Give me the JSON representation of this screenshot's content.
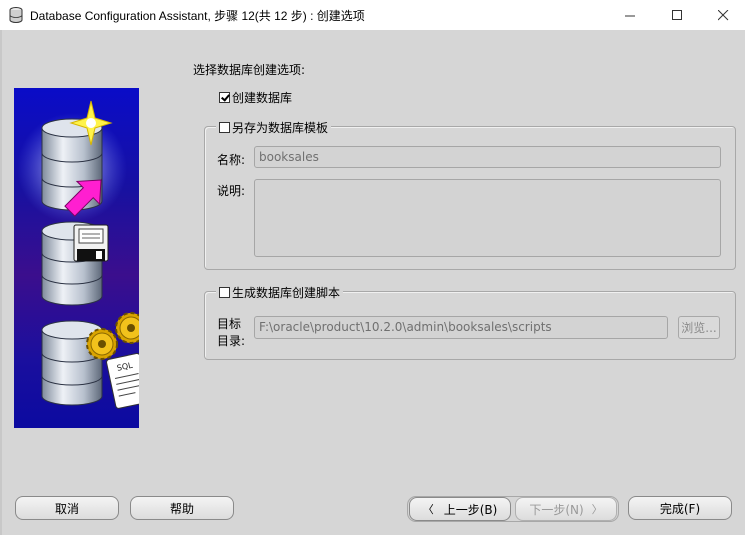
{
  "window": {
    "title": "Database Configuration Assistant, 步骤 12(共 12 步) : 创建选项",
    "minimize": "—",
    "maximize": "☐",
    "close": "✕"
  },
  "content": {
    "heading": "选择数据库创建选项:",
    "create_db": {
      "label": "创建数据库",
      "checked": true
    },
    "template_group": {
      "label": "另存为数据库模板",
      "checked": false,
      "name_label": "名称:",
      "name_value": "booksales",
      "desc_label": "说明:",
      "desc_value": ""
    },
    "script_group": {
      "label": "生成数据库创建脚本",
      "checked": false,
      "dir_label_line1": "目标",
      "dir_label_line2": "目录:",
      "dir_value": "F:\\oracle\\product\\10.2.0\\admin\\booksales\\scripts",
      "browse_label": "浏览..."
    }
  },
  "footer": {
    "cancel": "取消",
    "help": "帮助",
    "back": "上一步(B)",
    "next": "下一步(N)",
    "finish": "完成(F)"
  },
  "icons": {
    "app": "database-app-icon",
    "back_arrow": "chevron-left-icon",
    "next_arrow": "chevron-right-icon"
  },
  "colors": {
    "panel_bg": "#d6d6d6",
    "image_blue": "#0a0cc8",
    "arrow_magenta": "#ff1fd0"
  }
}
